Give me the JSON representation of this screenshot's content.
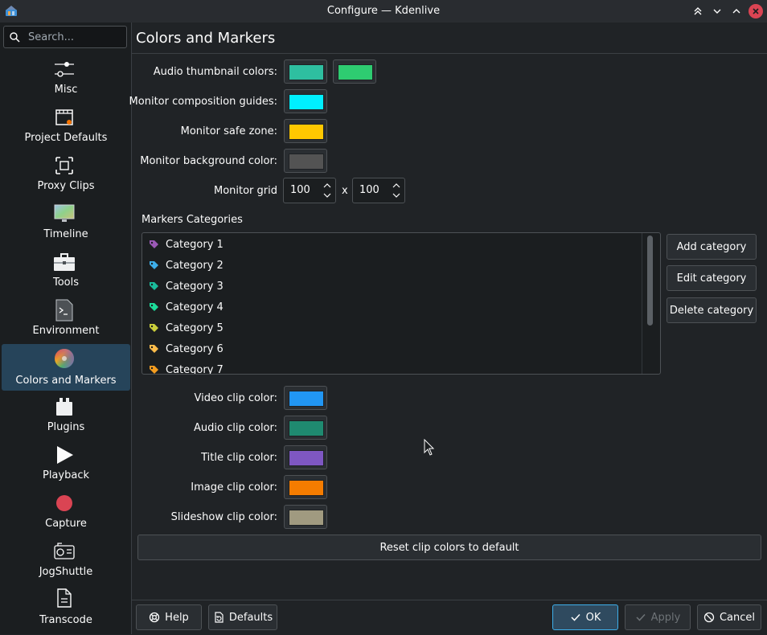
{
  "window": {
    "title": "Configure — Kdenlive"
  },
  "search": {
    "placeholder": "Search..."
  },
  "sidebar": {
    "items": [
      {
        "label": "Misc",
        "icon": "sliders-icon"
      },
      {
        "label": "Project Defaults",
        "icon": "film-settings-icon"
      },
      {
        "label": "Proxy Clips",
        "icon": "proxy-frame-icon"
      },
      {
        "label": "Timeline",
        "icon": "monitor-gradient-icon"
      },
      {
        "label": "Tools",
        "icon": "toolbox-icon"
      },
      {
        "label": "Environment",
        "icon": "terminal-file-icon"
      },
      {
        "label": "Colors and Markers",
        "icon": "color-wheel-icon"
      },
      {
        "label": "Plugins",
        "icon": "plugin-icon"
      },
      {
        "label": "Playback",
        "icon": "play-icon"
      },
      {
        "label": "Capture",
        "icon": "record-icon"
      },
      {
        "label": "JogShuttle",
        "icon": "jogshuttle-icon"
      },
      {
        "label": "Transcode",
        "icon": "transcode-file-icon"
      }
    ],
    "active": "Colors and Markers"
  },
  "page": {
    "title": "Colors and Markers"
  },
  "form": {
    "audio_thumb_label": "Audio thumbnail colors:",
    "audio_thumb_colors": [
      "#2ebfa0",
      "#2ecc71"
    ],
    "composition_label": "Monitor composition guides:",
    "composition_color": "#00f0ff",
    "safe_zone_label": "Monitor safe zone:",
    "safe_zone_color": "#ffc800",
    "bg_label": "Monitor background color:",
    "bg_color": "#535353",
    "grid_label": "Monitor grid",
    "grid_x": "100",
    "grid_sep": "x",
    "grid_y": "100"
  },
  "markers": {
    "section_label": "Markers Categories",
    "categories": [
      {
        "name": "Category 1",
        "color": "#9b59b6"
      },
      {
        "name": "Category 2",
        "color": "#3daee9"
      },
      {
        "name": "Category 3",
        "color": "#1abc9c"
      },
      {
        "name": "Category 4",
        "color": "#1cdc9a"
      },
      {
        "name": "Category 5",
        "color": "#c9ce3b"
      },
      {
        "name": "Category 6",
        "color": "#fdbc4b"
      },
      {
        "name": "Category 7",
        "color": "#f39c1f"
      }
    ],
    "add_label": "Add category",
    "edit_label": "Edit category",
    "delete_label": "Delete category"
  },
  "clips": {
    "video_label": "Video clip color:",
    "video_color": "#2196f3",
    "audio_label": "Audio clip color:",
    "audio_color": "#1f8a70",
    "title_label": "Title clip color:",
    "title_color": "#7e57c2",
    "image_label": "Image clip color:",
    "image_color": "#f57c00",
    "slideshow_label": "Slideshow clip color:",
    "slideshow_color": "#a09a80",
    "reset_label": "Reset clip colors to default"
  },
  "footer": {
    "help_label": "Help",
    "defaults_label": "Defaults",
    "ok_label": "OK",
    "apply_label": "Apply",
    "cancel_label": "Cancel"
  },
  "theme": {
    "accent": "#3daee9",
    "selected_bg": "#26445a",
    "close_red": "#da4453"
  }
}
